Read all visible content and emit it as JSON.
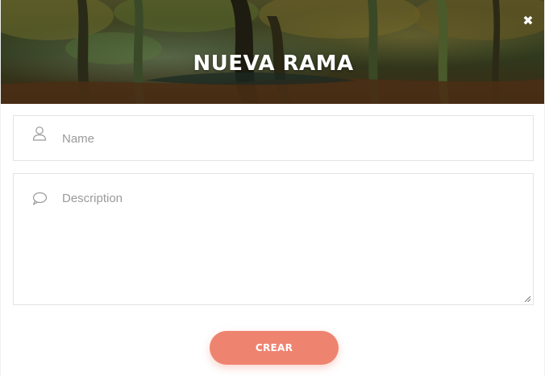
{
  "modal": {
    "title": "NUEVA RAMA",
    "close_icon": "close-icon",
    "header_image": "forest-background"
  },
  "form": {
    "name": {
      "icon": "user-icon",
      "placeholder": "Name",
      "value": ""
    },
    "description": {
      "icon": "speech-bubble-icon",
      "placeholder": "Description",
      "value": ""
    },
    "submit_label": "CREAR"
  },
  "colors": {
    "accent": "#ee8470",
    "field_border": "#e3e3e3",
    "placeholder": "#9a9a9a"
  }
}
